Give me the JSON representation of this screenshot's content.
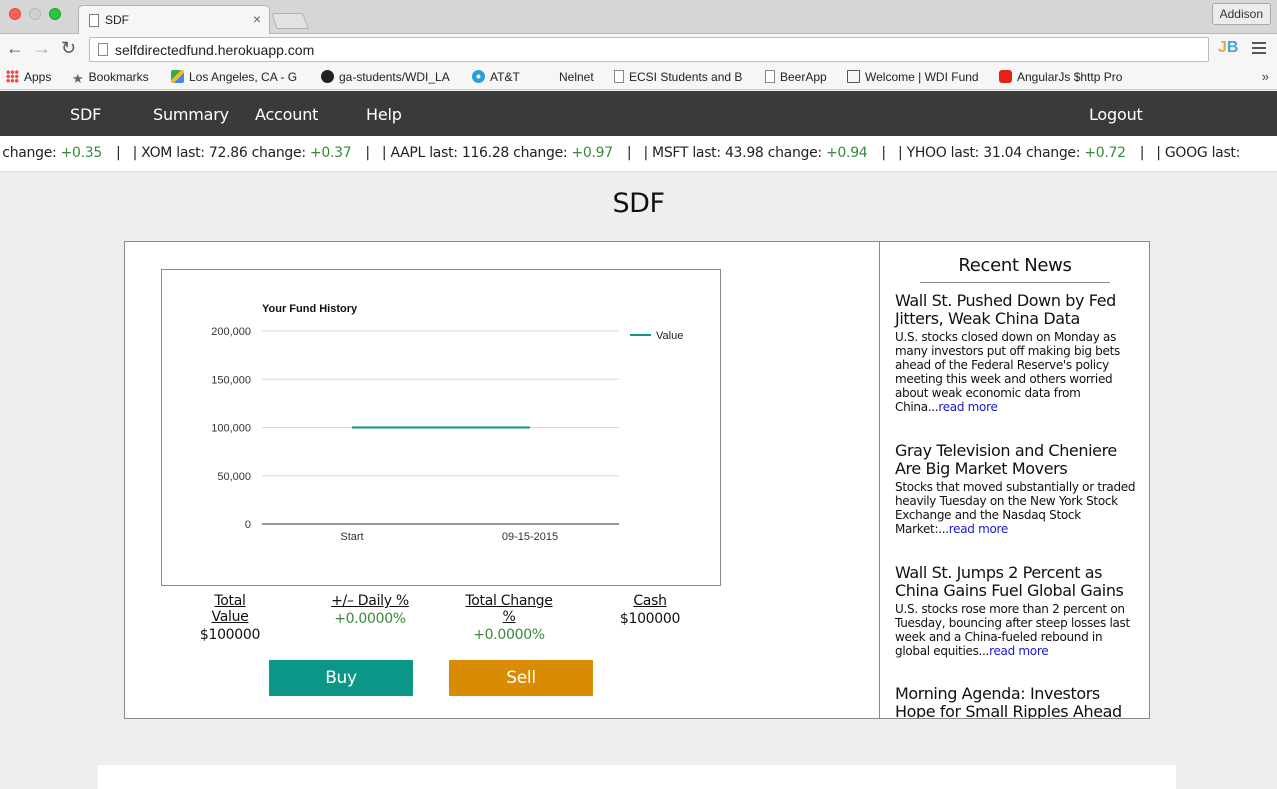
{
  "browser": {
    "tab_title": "SDF",
    "tab_close": "×",
    "profile": "Addison",
    "url": "selfdirectedfund.herokuapp.com",
    "back": "←",
    "forward": "→",
    "reload": "↻",
    "ext_jb": "JB",
    "bookmarks_more": "»",
    "bookmarks": [
      {
        "label": "Apps",
        "icon": "apps-icon"
      },
      {
        "label": "Bookmarks",
        "icon": "star-icon"
      },
      {
        "label": "Los Angeles, CA - G",
        "icon": "map-icon"
      },
      {
        "label": "ga-students/WDI_LA",
        "icon": "github-icon"
      },
      {
        "label": "AT&T",
        "icon": "att-icon"
      },
      {
        "label": "Nelnet",
        "icon": "none"
      },
      {
        "label": "ECSI Students and B",
        "icon": "page-icon"
      },
      {
        "label": "BeerApp",
        "icon": "page-icon"
      },
      {
        "label": "Welcome | WDI Fund",
        "icon": "book-icon"
      },
      {
        "label": "AngularJs $http Pro",
        "icon": "youtube-icon"
      }
    ]
  },
  "nav": {
    "brand": "SDF",
    "summary": "Summary",
    "account": "Account",
    "help": "Help",
    "logout": "Logout"
  },
  "ticker": {
    "lead": ". change:",
    "lead_change": "+0.35",
    "items": [
      {
        "sym": "XOM",
        "last": "72.86",
        "change": "+0.37"
      },
      {
        "sym": "AAPL",
        "last": "116.28",
        "change": "+0.97"
      },
      {
        "sym": "MSFT",
        "last": "43.98",
        "change": "+0.94"
      },
      {
        "sym": "YHOO",
        "last": "31.04",
        "change": "+0.72"
      },
      {
        "sym": "GOOG",
        "last": "",
        "change": ""
      }
    ]
  },
  "page_title": "SDF",
  "chart_data": {
    "type": "line",
    "title": "Your Fund History",
    "categories": [
      "Start",
      "09-15-2015"
    ],
    "series": [
      {
        "name": "Value",
        "values": [
          100000,
          100000
        ],
        "color": "#0b9687"
      }
    ],
    "yticks": [
      "0",
      "50,000",
      "100,000",
      "150,000",
      "200,000"
    ],
    "ylim": [
      0,
      200000
    ],
    "grid": true,
    "legend": "right"
  },
  "stats": {
    "total_value_label": "Total Value",
    "total_value": "$100000",
    "daily_label": "+/– Daily %",
    "daily": "+0.0000%",
    "total_change_label": "Total Change %",
    "total_change": "+0.0000%",
    "cash_label": "Cash",
    "cash": "$100000"
  },
  "actions": {
    "buy": "Buy",
    "sell": "Sell"
  },
  "colors": {
    "buy": "#0b9687",
    "sell": "#d98c03",
    "positive": "#3a8a3a",
    "nav_bg": "#3a3a3a",
    "link": "#1a1acc"
  },
  "news": {
    "heading": "Recent News",
    "articles": [
      {
        "title": "Wall St. Pushed Down by Fed Jitters, Weak China Data",
        "summary": "U.S. stocks closed down on Monday as many investors put off making big bets ahead of the Federal Reserve's policy meeting this week and others worried about weak economic data from China...",
        "more": "read more"
      },
      {
        "title": "Gray Television and Cheniere Are Big Market Movers",
        "summary": "Stocks that moved substantially or traded heavily Tuesday on the New York Stock Exchange and the Nasdaq Stock Market:...",
        "more": "read more"
      },
      {
        "title": "Wall St. Jumps 2 Percent as China Gains Fuel Global Gains",
        "summary": "U.S. stocks rose more than 2 percent on Tuesday, bouncing after steep losses last week and a China-fueled rebound in global equities...",
        "more": "read more"
      },
      {
        "title": "Morning Agenda: Investors Hope for Small Ripples Ahead of Fed",
        "summary": "",
        "more": ""
      }
    ]
  }
}
